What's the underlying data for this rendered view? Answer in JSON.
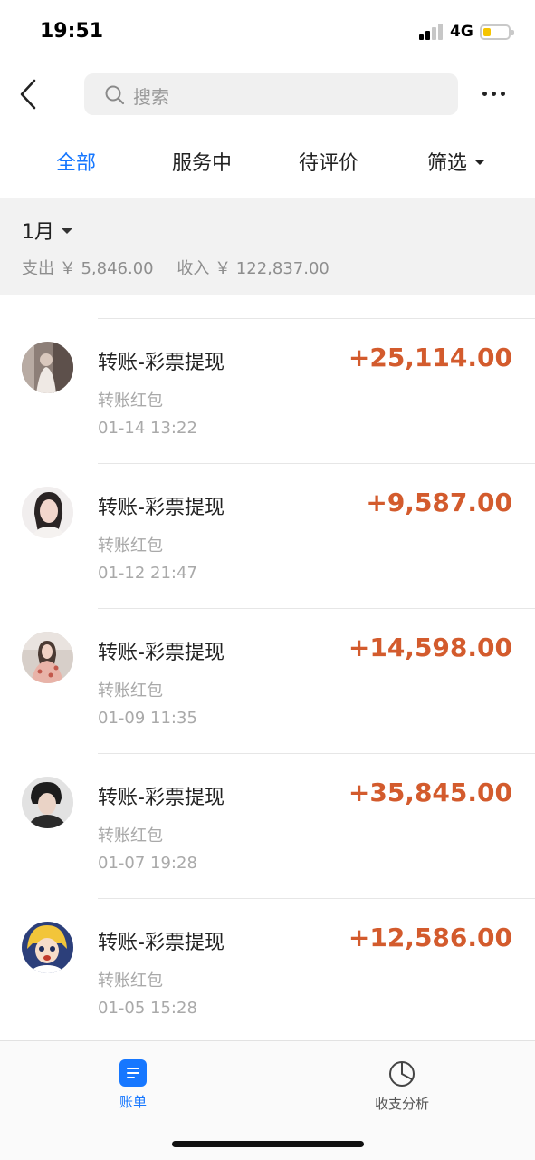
{
  "status_bar": {
    "time": "19:51",
    "network": "4G"
  },
  "header": {
    "search_placeholder": "搜索"
  },
  "tabs": [
    {
      "label": "全部"
    },
    {
      "label": "服务中"
    },
    {
      "label": "待评价"
    },
    {
      "label": "筛选"
    }
  ],
  "month_panel": {
    "month": "1月",
    "expense": "支出 ￥ 5,846.00",
    "income": "收入 ￥ 122,837.00"
  },
  "transactions": [
    {
      "title": "转账-彩票提现",
      "subtitle": "转账红包",
      "time": "01-14 13:22",
      "amount": "+25,114.00"
    },
    {
      "title": "转账-彩票提现",
      "subtitle": "转账红包",
      "time": "01-12 21:47",
      "amount": "+9,587.00"
    },
    {
      "title": "转账-彩票提现",
      "subtitle": "转账红包",
      "time": "01-09 11:35",
      "amount": "+14,598.00"
    },
    {
      "title": "转账-彩票提现",
      "subtitle": "转账红包",
      "time": "01-07 19:28",
      "amount": "+35,845.00"
    },
    {
      "title": "转账-彩票提现",
      "subtitle": "转账红包",
      "time": "01-05 15:28",
      "amount": "+12,586.00"
    }
  ],
  "tabbar": {
    "bill_label": "账单",
    "analysis_label": "收支分析"
  },
  "colors": {
    "accent": "#1677ff",
    "income_amount": "#d35b2d",
    "muted_text": "#a9a9a9"
  }
}
